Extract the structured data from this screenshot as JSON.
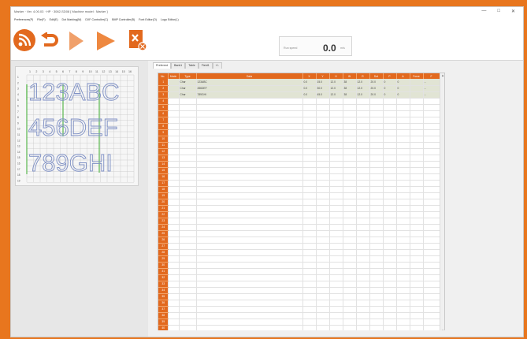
{
  "window": {
    "title": "Marker  ·  Ver. 4.00.03   ·   HP · 3082-SD08          [ Machine model : Marker ]",
    "controls": [
      "—",
      "□",
      "✕"
    ]
  },
  "menu": {
    "items": [
      "Preferences(P)",
      "File(F)",
      "Edit(E)",
      "Dot Marking(M)",
      "DXF Controller(C)",
      "BMP Controller(B)",
      "Font Editor(O)",
      "Logo Editor(L)"
    ]
  },
  "toolbar": {
    "buttons": [
      {
        "name": "connect-button",
        "icon": "connection-icon"
      },
      {
        "name": "return-button",
        "icon": "return-icon"
      },
      {
        "name": "play-button",
        "icon": "play-icon"
      },
      {
        "name": "run-button",
        "icon": "run-icon"
      },
      {
        "name": "clear-button",
        "icon": "clear-icon"
      }
    ],
    "speed": {
      "label": "Run speed",
      "value": "0.0",
      "unit": "m/s"
    }
  },
  "preview": {
    "ruler_top": [
      "1",
      "2",
      "3",
      "4",
      "5",
      "6",
      "7",
      "8",
      "9",
      "10",
      "11",
      "12",
      "13",
      "14",
      "15",
      "16"
    ],
    "ruler_left": [
      "1",
      "2",
      "3",
      "4",
      "5",
      "6",
      "7",
      "8",
      "9",
      "10",
      "11",
      "12",
      "13",
      "14",
      "15",
      "16",
      "17",
      "18",
      "19",
      "20"
    ],
    "lines": [
      "123ABC",
      "456DEF",
      "789GHI"
    ]
  },
  "tabs": [
    "Preferred",
    "Bank1",
    "Table",
    "Field1",
    "+/-"
  ],
  "table": {
    "columns": [
      "No.",
      "Mode",
      "Type",
      "Data",
      "X",
      "Y",
      "H",
      "W",
      "R",
      "Dot",
      "P",
      "A",
      "Force",
      "F"
    ],
    "rows": [
      [
        "1",
        "",
        "Char",
        "123ABC",
        "0.0",
        "15.0",
        "12.0",
        "38",
        "12.0",
        "20.0",
        "0",
        "0",
        "",
        "..."
      ],
      [
        "2",
        "",
        "Char",
        "456DEF",
        "0.0",
        "30.0",
        "12.0",
        "38",
        "12.0",
        "20.0",
        "0",
        "0",
        "",
        "..."
      ],
      [
        "3",
        "",
        "Char",
        "789GHI",
        "0.0",
        "45.0",
        "12.0",
        "38",
        "12.0",
        "20.0",
        "0",
        "0",
        "",
        "..."
      ]
    ],
    "row_numbers": [
      "1",
      "2",
      "3",
      "4",
      "5",
      "6",
      "7",
      "8",
      "9",
      "10",
      "11",
      "12",
      "13",
      "14",
      "15",
      "16",
      "17",
      "18",
      "19",
      "20",
      "21",
      "22",
      "23",
      "24",
      "25",
      "26",
      "27",
      "28",
      "29",
      "30",
      "31",
      "32",
      "33",
      "34",
      "35",
      "36",
      "37",
      "38",
      "39",
      "40"
    ]
  },
  "colors": {
    "accent": "#e2691e",
    "border": "#e8761e",
    "preview_text": "#7d8fc4",
    "preview_grid": "#5ab84e"
  }
}
